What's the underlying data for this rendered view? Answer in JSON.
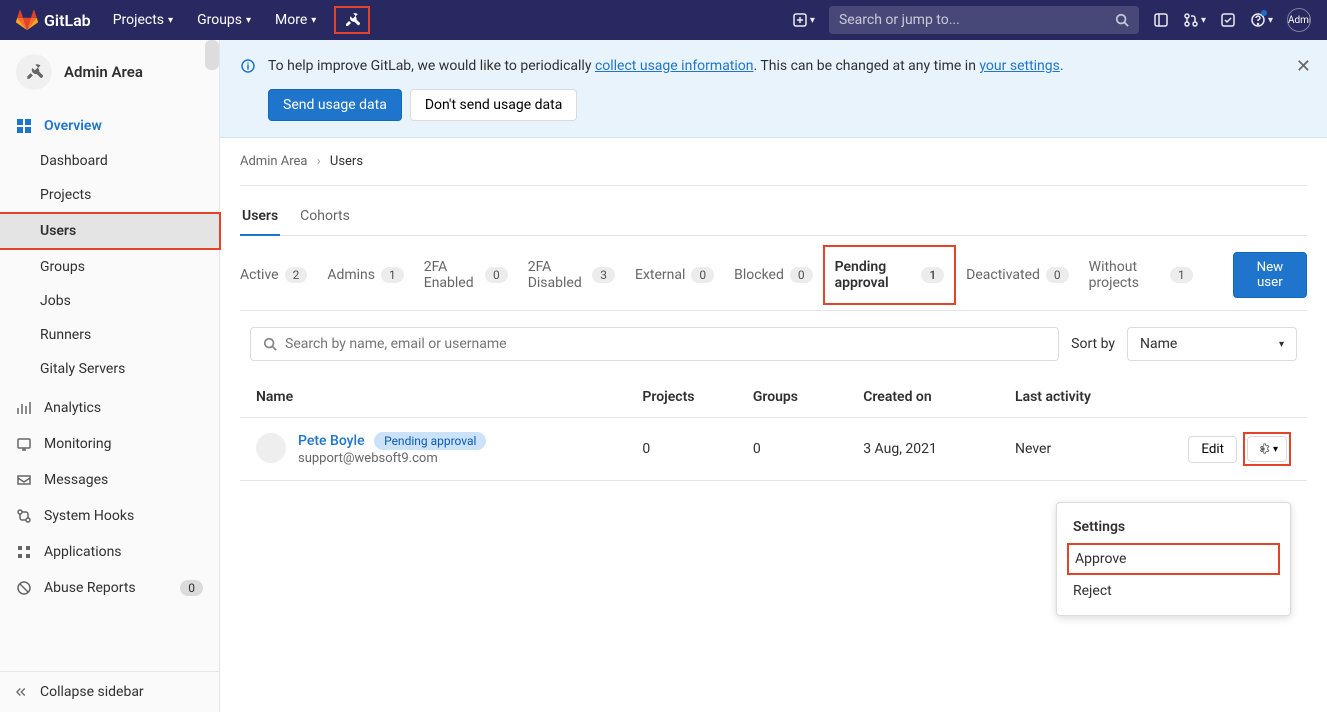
{
  "topnav": {
    "brand": "GitLab",
    "items": [
      "Projects",
      "Groups",
      "More"
    ],
    "search_placeholder": "Search or jump to...",
    "user_label": "Administrator"
  },
  "sidebar": {
    "title": "Admin Area",
    "overview": "Overview",
    "subitems": [
      "Dashboard",
      "Projects",
      "Users",
      "Groups",
      "Jobs",
      "Runners",
      "Gitaly Servers"
    ],
    "items": [
      {
        "label": "Analytics"
      },
      {
        "label": "Monitoring"
      },
      {
        "label": "Messages"
      },
      {
        "label": "System Hooks"
      },
      {
        "label": "Applications"
      },
      {
        "label": "Abuse Reports",
        "count": "0"
      }
    ],
    "collapse": "Collapse sidebar"
  },
  "banner": {
    "text_before": "To help improve GitLab, we would like to periodically ",
    "link1": "collect usage information",
    "text_mid": ". This can be changed at any time in ",
    "link2": "your settings",
    "text_after": ".",
    "send": "Send usage data",
    "dont_send": "Don't send usage data"
  },
  "breadcrumb": {
    "root": "Admin Area",
    "current": "Users"
  },
  "main_tabs": [
    "Users",
    "Cohorts"
  ],
  "filters": [
    {
      "label": "Active",
      "count": "2"
    },
    {
      "label": "Admins",
      "count": "1"
    },
    {
      "label": "2FA Enabled",
      "count": "0"
    },
    {
      "label": "2FA Disabled",
      "count": "3"
    },
    {
      "label": "External",
      "count": "0"
    },
    {
      "label": "Blocked",
      "count": "0"
    },
    {
      "label": "Pending approval",
      "count": "1"
    },
    {
      "label": "Deactivated",
      "count": "0"
    },
    {
      "label": "Without projects",
      "count": "1"
    }
  ],
  "new_user": "New user",
  "search": {
    "placeholder": "Search by name, email or username"
  },
  "sort": {
    "label": "Sort by",
    "value": "Name"
  },
  "table": {
    "headers": {
      "name": "Name",
      "projects": "Projects",
      "groups": "Groups",
      "created": "Created on",
      "activity": "Last activity"
    },
    "rows": [
      {
        "name": "Pete Boyle",
        "status": "Pending approval",
        "email": "support@websoft9.com",
        "projects": "0",
        "groups": "0",
        "created": "3 Aug, 2021",
        "activity": "Never",
        "edit": "Edit"
      }
    ]
  },
  "dropdown": {
    "header": "Settings",
    "approve": "Approve",
    "reject": "Reject"
  }
}
